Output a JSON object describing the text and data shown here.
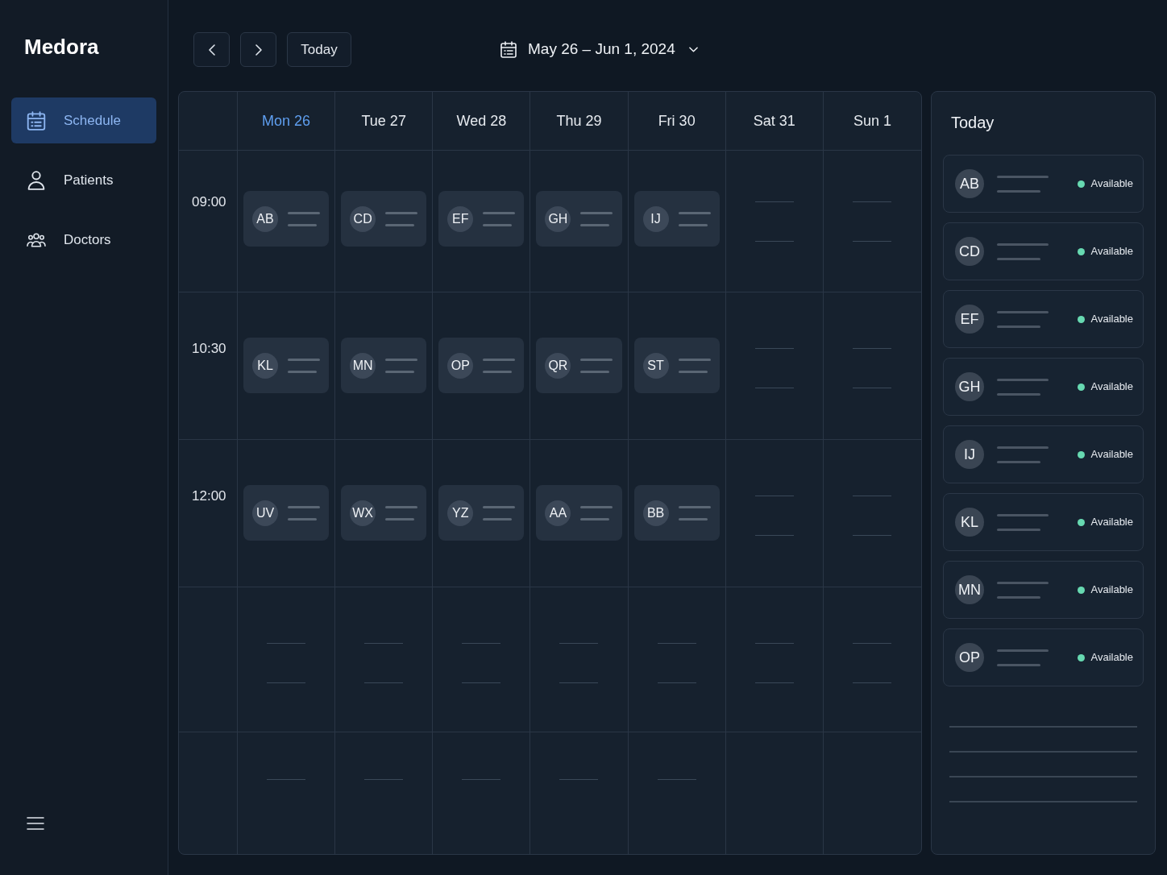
{
  "sidebar": {
    "logo": "Medora",
    "nav": [
      {
        "label": "Schedule",
        "selected": true
      },
      {
        "label": "Patients",
        "selected": false
      },
      {
        "label": "Doctors",
        "selected": false
      }
    ]
  },
  "toolbar": {
    "today_button": "Today",
    "date_range": "May 26 – Jun 1, 2024"
  },
  "calendar": {
    "days": [
      {
        "label": "Mon 26",
        "selected": true
      },
      {
        "label": "Tue 27",
        "selected": false
      },
      {
        "label": "Wed 28",
        "selected": false
      },
      {
        "label": "Thu 29",
        "selected": false
      },
      {
        "label": "Fri 30",
        "selected": false
      },
      {
        "label": "Sat 31",
        "selected": false
      },
      {
        "label": "Sun 1",
        "selected": false
      }
    ],
    "rows": [
      {
        "time": "09:00",
        "cells": [
          {
            "kind": "appointment",
            "initials": "AB"
          },
          {
            "kind": "appointment",
            "initials": "CD"
          },
          {
            "kind": "appointment",
            "initials": "EF"
          },
          {
            "kind": "appointment",
            "initials": "GH"
          },
          {
            "kind": "appointment",
            "initials": "IJ"
          },
          {
            "kind": "double"
          },
          {
            "kind": "double"
          }
        ]
      },
      {
        "time": "10:30",
        "cells": [
          {
            "kind": "appointment",
            "initials": "KL"
          },
          {
            "kind": "appointment",
            "initials": "MN"
          },
          {
            "kind": "appointment",
            "initials": "OP"
          },
          {
            "kind": "appointment",
            "initials": "QR"
          },
          {
            "kind": "appointment",
            "initials": "ST"
          },
          {
            "kind": "double"
          },
          {
            "kind": "double"
          }
        ]
      },
      {
        "time": "12:00",
        "cells": [
          {
            "kind": "appointment",
            "initials": "UV"
          },
          {
            "kind": "appointment",
            "initials": "WX"
          },
          {
            "kind": "appointment",
            "initials": "YZ"
          },
          {
            "kind": "appointment",
            "initials": "AA"
          },
          {
            "kind": "appointment",
            "initials": "BB"
          },
          {
            "kind": "double"
          },
          {
            "kind": "double"
          }
        ]
      },
      {
        "cells": [
          {
            "kind": "double"
          },
          {
            "kind": "double"
          },
          {
            "kind": "double"
          },
          {
            "kind": "double"
          },
          {
            "kind": "double"
          },
          {
            "kind": "double"
          },
          {
            "kind": "double"
          }
        ]
      },
      {
        "cells": [
          {
            "kind": "single"
          },
          {
            "kind": "single"
          },
          {
            "kind": "single"
          },
          {
            "kind": "single"
          },
          {
            "kind": "single"
          },
          {
            "kind": "blank"
          },
          {
            "kind": "blank"
          }
        ]
      }
    ]
  },
  "today_panel": {
    "title": "Today",
    "doctors": [
      {
        "initials": "AB",
        "status": "Available",
        "color": "#67d9b1"
      },
      {
        "initials": "CD",
        "status": "Available",
        "color": "#67d9b1"
      },
      {
        "initials": "EF",
        "status": "Available",
        "color": "#67d9b1"
      },
      {
        "initials": "GH",
        "status": "Available",
        "color": "#67d9b1"
      },
      {
        "initials": "IJ",
        "status": "Available",
        "color": "#67d9b1"
      },
      {
        "initials": "KL",
        "status": "Available",
        "color": "#67d9b1"
      },
      {
        "initials": "MN",
        "status": "Available",
        "color": "#67d9b1"
      },
      {
        "initials": "OP",
        "status": "Available",
        "color": "#67d9b1"
      }
    ]
  }
}
